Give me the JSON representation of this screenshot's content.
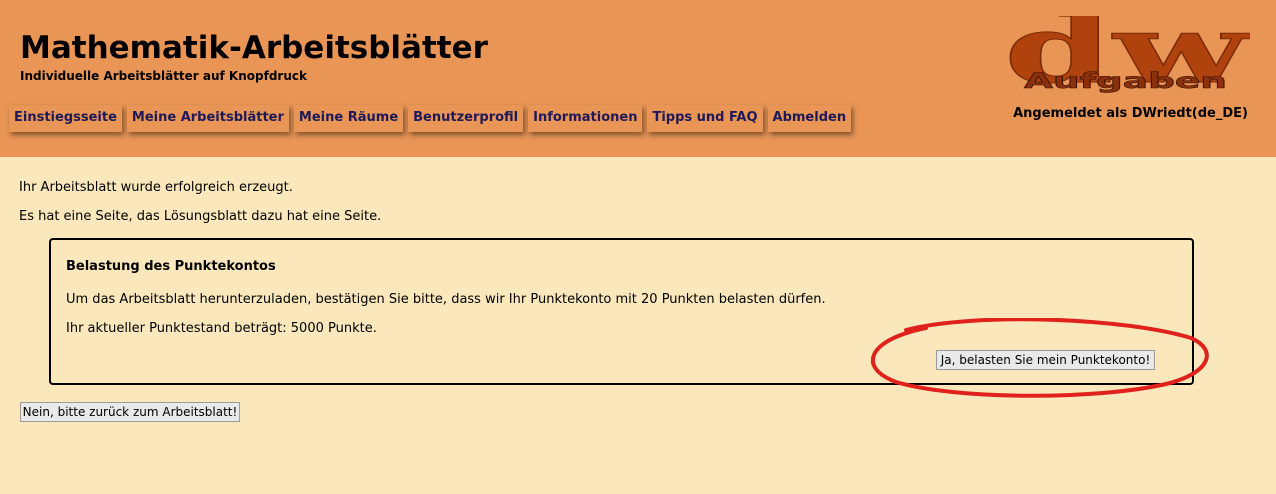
{
  "header": {
    "title": "Mathematik-Arbeitsblätter",
    "subtitle": "Individuelle Arbeitsblätter auf Knopfdruck",
    "logo_big": "dw",
    "logo_small": "Aufgaben",
    "logged_in": "Angemeldet als DWriedt(de_DE)"
  },
  "nav": {
    "items": [
      {
        "label": "Einstiegsseite"
      },
      {
        "label": "Meine Arbeitsblätter"
      },
      {
        "label": "Meine Räume"
      },
      {
        "label": "Benutzerprofil"
      },
      {
        "label": "Informationen"
      },
      {
        "label": "Tipps und FAQ"
      },
      {
        "label": "Abmelden"
      }
    ]
  },
  "main": {
    "message1": "Ihr Arbeitsblatt wurde erfolgreich erzeugt.",
    "message2": "Es hat eine Seite, das Lösungsblatt dazu hat eine Seite.",
    "box": {
      "title": "Belastung des Punktekontos",
      "line1": "Um das Arbeitsblatt herunterzuladen, bestätigen Sie bitte, dass wir Ihr Punktekonto mit 20 Punkten belasten dürfen.",
      "line2": "Ihr aktueller Punktestand beträgt: 5000 Punkte.",
      "confirm_label": "Ja, belasten Sie mein Punktekonto!"
    },
    "back_label": "Nein, bitte zurück zum Arbeitsblatt!"
  },
  "colors": {
    "header_bg": "#e99555",
    "page_bg": "#fae8bc",
    "nav_text": "#1e1a5a",
    "logo_fill": "#b0420e",
    "annotation": "#e0211c"
  }
}
